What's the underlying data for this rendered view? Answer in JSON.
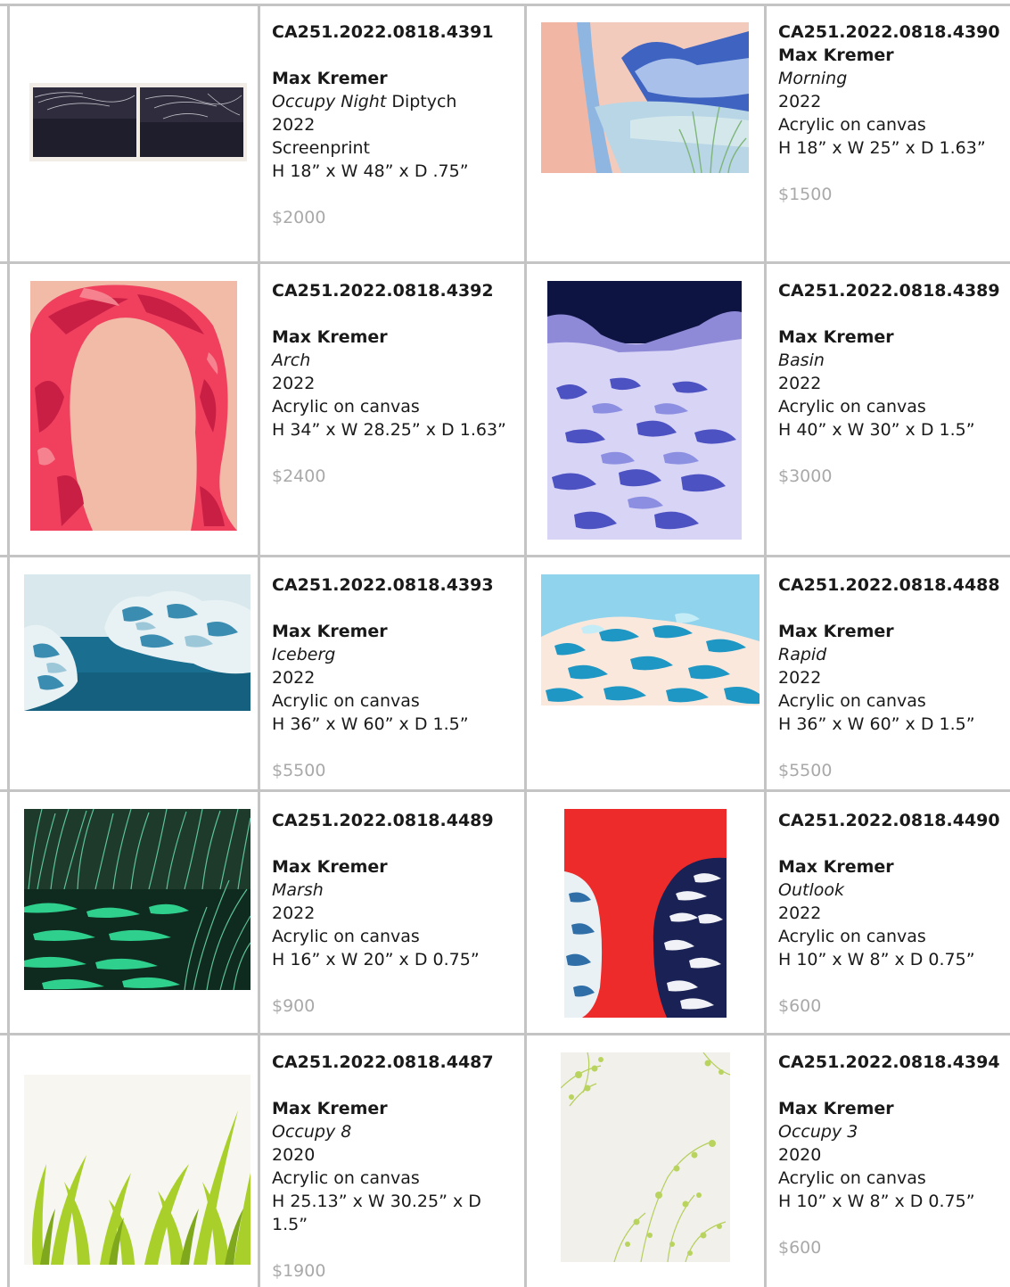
{
  "rows": [
    [
      {
        "catalog": "CA251.2022.0818.4391",
        "artist": "Max Kremer",
        "title": "Occupy Night",
        "title_suffix": " Diptych",
        "year": "2022",
        "medium": "Screenprint",
        "dims": "H 18” x W 48” x D .75”",
        "price": "$2000"
      },
      {
        "catalog": "CA251.2022.0818.4390",
        "artist": "Max Kremer",
        "title": "Morning",
        "title_suffix": "",
        "year": "2022",
        "medium": "Acrylic on canvas",
        "dims": "H 18” x W 25” x D 1.63”",
        "price": "$1500"
      }
    ],
    [
      {
        "catalog": "CA251.2022.0818.4392",
        "artist": "Max Kremer",
        "title": "Arch",
        "title_suffix": "",
        "year": "2022",
        "medium": "Acrylic on canvas",
        "dims": "H 34” x W 28.25” x D 1.63”",
        "price": "$2400"
      },
      {
        "catalog": "CA251.2022.0818.4389",
        "artist": "Max Kremer",
        "title": "Basin",
        "title_suffix": "",
        "year": "2022",
        "medium": "Acrylic on canvas",
        "dims": "H 40” x W 30” x D 1.5”",
        "price": "$3000"
      }
    ],
    [
      {
        "catalog": "CA251.2022.0818.4393",
        "artist": "Max Kremer",
        "title": "Iceberg",
        "title_suffix": "",
        "year": "2022",
        "medium": "Acrylic on canvas",
        "dims": "H 36” x W 60” x D 1.5”",
        "price": "$5500"
      },
      {
        "catalog": "CA251.2022.0818.4488",
        "artist": "Max Kremer",
        "title": "Rapid",
        "title_suffix": "",
        "year": "2022",
        "medium": "Acrylic on canvas",
        "dims": "H 36” x W 60” x D 1.5”",
        "price": "$5500"
      }
    ],
    [
      {
        "catalog": "CA251.2022.0818.4489",
        "artist": "Max Kremer",
        "title": "Marsh",
        "title_suffix": "",
        "year": "2022",
        "medium": "Acrylic on canvas",
        "dims": "H 16” x W 20” x D 0.75”",
        "price": "$900"
      },
      {
        "catalog": "CA251.2022.0818.4490",
        "artist": "Max Kremer",
        "title": "Outlook",
        "title_suffix": "",
        "year": "2022",
        "medium": "Acrylic on canvas",
        "dims": "H 10” x W 8” x D 0.75”",
        "price": "$600"
      }
    ],
    [
      {
        "catalog": "CA251.2022.0818.4487",
        "artist": "Max Kremer",
        "title": "Occupy 8",
        "title_suffix": "",
        "year": "2020",
        "medium": "Acrylic on canvas",
        "dims": "H 25.13” x W 30.25” x D 1.5”",
        "price": "$1900"
      },
      {
        "catalog": "CA251.2022.0818.4394",
        "artist": "Max Kremer",
        "title": "Occupy 3",
        "title_suffix": "",
        "year": "2020",
        "medium": "Acrylic on canvas",
        "dims": "H 10” x W 8” x D 0.75”",
        "price": "$600"
      }
    ]
  ],
  "colors": {
    "grid": "#c4c4c4",
    "price": "#a9a9a9",
    "text": "#1a1a1a"
  }
}
